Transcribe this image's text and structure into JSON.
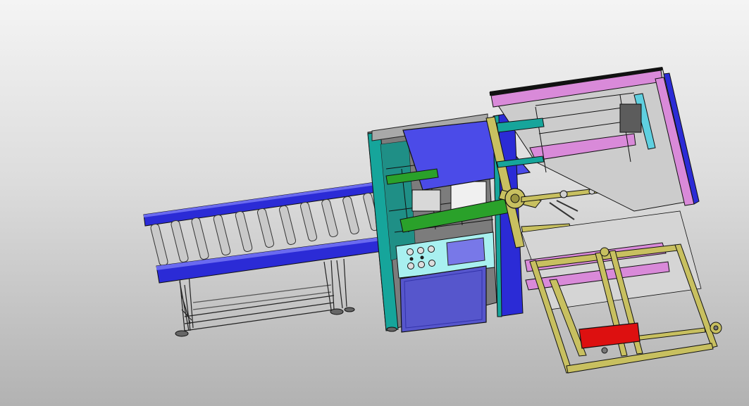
{
  "viewport": {
    "background_top": "#f4f4f4",
    "background_bottom": "#b2b2b2"
  },
  "model": {
    "colors": {
      "conveyor_blue": "#2b2bd6",
      "conveyor_blue_dark": "#1a1a9a",
      "frame_cyan": "#16a59b",
      "frame_gray": "#7c7c7c",
      "panel_blue": "#5656cc",
      "control_panel": "#a8f0f0",
      "screen": "#7878e8",
      "arm_olive": "#c8c060",
      "arm_green": "#2aa12a",
      "magenta_panel": "#d98ad9",
      "red_plate": "#dd1010",
      "roller": "#c9c9c9"
    }
  }
}
